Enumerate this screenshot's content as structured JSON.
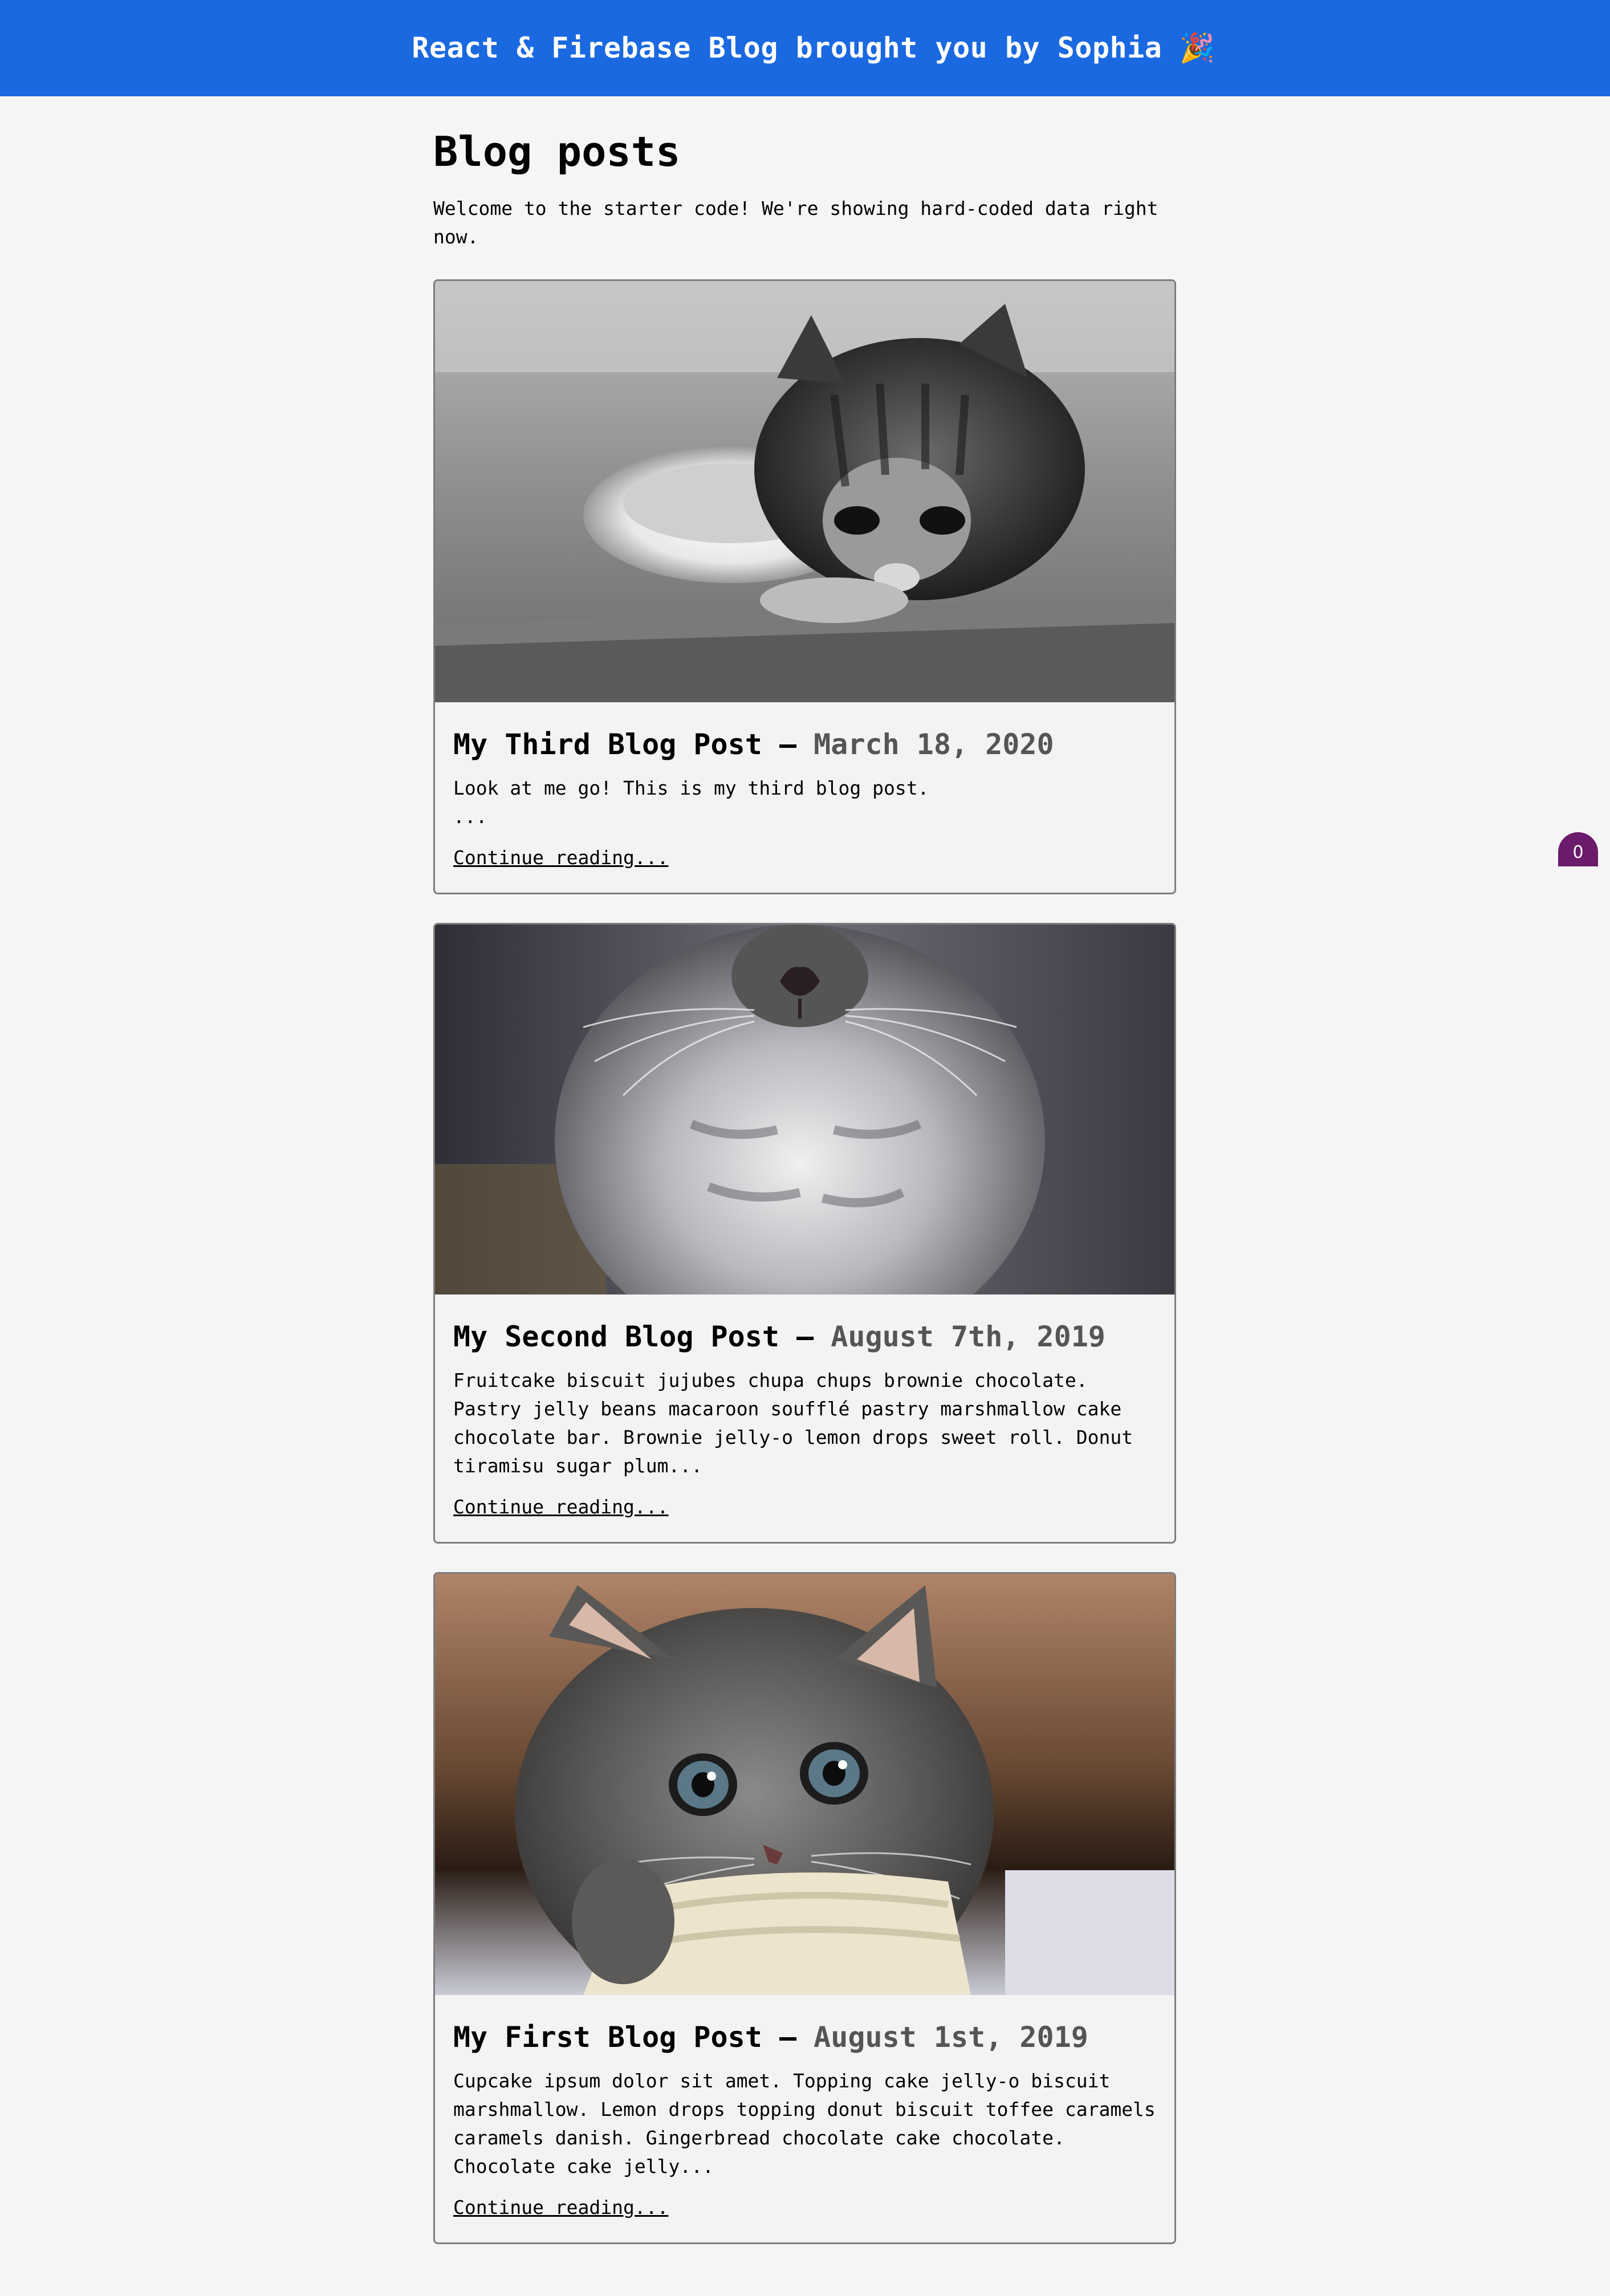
{
  "header": {
    "title": "React & Firebase Blog brought you by Sophia 🎉"
  },
  "main": {
    "title": "Blog posts",
    "intro": "Welcome to the starter code! We're showing hard-coded data right now."
  },
  "posts": [
    {
      "title": "My Third Blog Post",
      "separator": " — ",
      "date": "March 18, 2020",
      "excerpt_line1": "Look at me go! This is my third blog post.",
      "excerpt_line2": "...",
      "link": "Continue reading...",
      "image_icon": "kitten-photo-bw"
    },
    {
      "title": "My Second Blog Post",
      "separator": " — ",
      "date": "August 7th, 2019",
      "excerpt": "Fruitcake biscuit jujubes chupa chups brownie chocolate. Pastry jelly beans macaroon soufflé pastry marshmallow cake chocolate bar. Brownie jelly-o lemon drops sweet roll. Donut tiramisu sugar plum...",
      "link": "Continue reading...",
      "image_icon": "kitten-photo-closeup"
    },
    {
      "title": "My First Blog Post",
      "separator": " — ",
      "date": "August 1st, 2019",
      "excerpt": "Cupcake ipsum dolor sit amet. Topping cake jelly-o biscuit marshmallow. Lemon drops topping donut biscuit toffee caramels caramels danish. Gingerbread chocolate cake chocolate. Chocolate cake jelly...",
      "link": "Continue reading...",
      "image_icon": "kitten-photo-color"
    }
  ],
  "badge": {
    "count": "0"
  },
  "colors": {
    "header_bg": "#1a69e0",
    "page_bg": "#f5f5f5",
    "date_color": "#555555",
    "badge_bg": "#6a1b6a"
  }
}
